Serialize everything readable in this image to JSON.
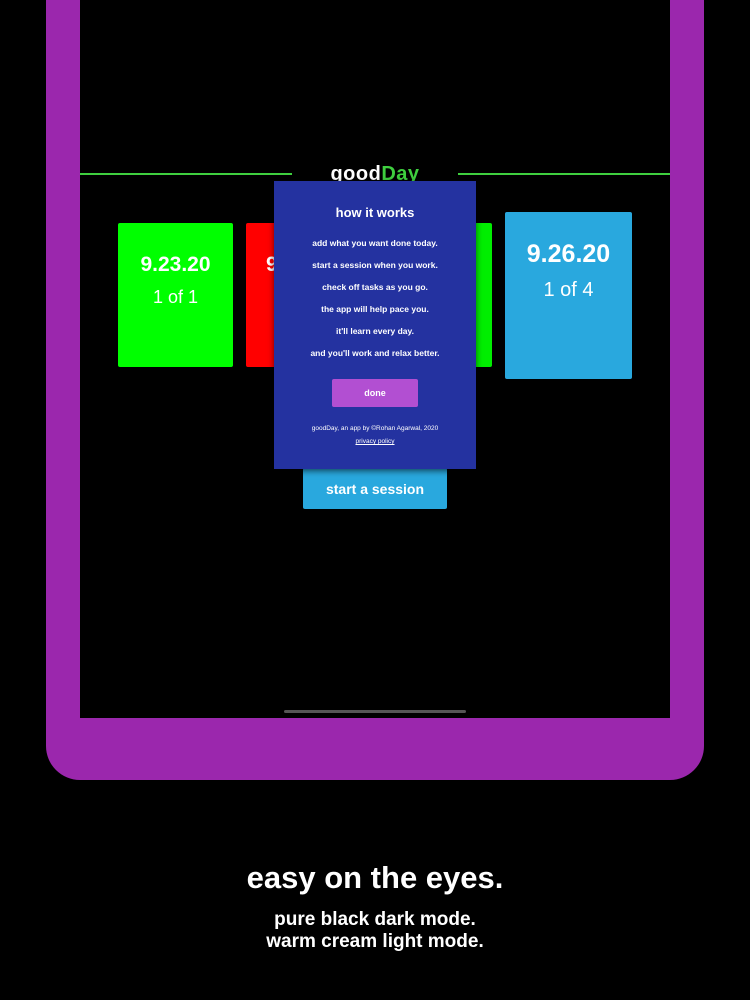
{
  "app": {
    "brand_prefix": "good",
    "brand_suffix": "Day",
    "accent_color": "#3fcf3f"
  },
  "cards": [
    {
      "date": "9.23.20",
      "count": "1 of 1",
      "color": "#00ff00"
    },
    {
      "date": "9",
      "count": "",
      "color": "#ff0000"
    },
    {
      "date": "",
      "count": "",
      "color": "#00ee00"
    },
    {
      "date": "9.26.20",
      "count": "1 of 4",
      "color": "#29a8de"
    }
  ],
  "session_button": {
    "label": "start a session"
  },
  "modal": {
    "title": "how it works",
    "steps": [
      "add what you want done today.",
      "start a session when you work.",
      "check off tasks as you go.",
      "the app will help pace you.",
      "it'll learn every day.",
      "and you'll work and relax better."
    ],
    "done_label": "done",
    "credit": "goodDay, an app by ©Rohan Agarwal, 2020",
    "privacy_label": "privacy policy"
  },
  "caption": {
    "headline": "easy on the eyes.",
    "line1": "pure black dark mode.",
    "line2": "warm cream light mode."
  }
}
